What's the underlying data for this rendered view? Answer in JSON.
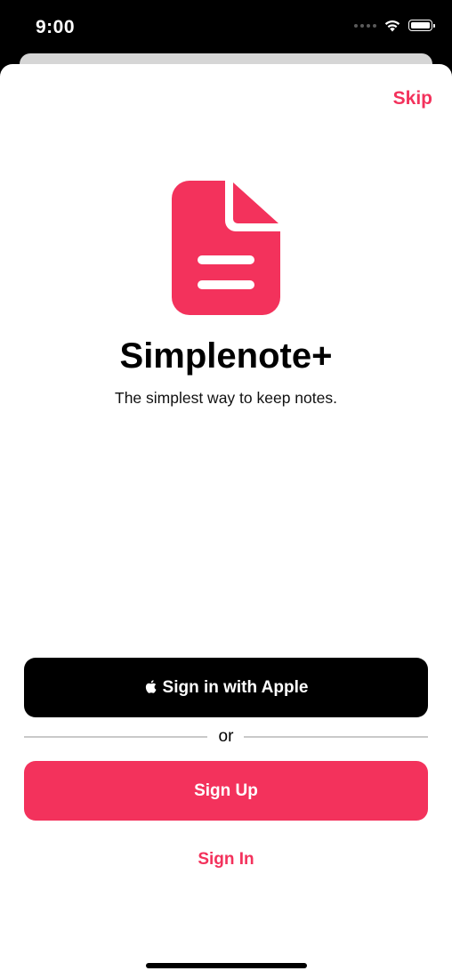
{
  "status_bar": {
    "time": "9:00",
    "signal_icon": "cellular-signal-icon",
    "wifi_icon": "wifi-icon",
    "battery_icon": "battery-icon"
  },
  "header": {
    "skip_label": "Skip"
  },
  "app": {
    "icon": "document-icon",
    "title": "Simplenote+",
    "tagline": "The simplest way to keep notes."
  },
  "actions": {
    "apple_icon": "apple-logo-icon",
    "apple_label": "Sign in with Apple",
    "or_label": "or",
    "signup_label": "Sign Up",
    "signin_label": "Sign In"
  },
  "colors": {
    "accent": "#f3325c",
    "apple_button": "#000000",
    "background": "#ffffff"
  }
}
